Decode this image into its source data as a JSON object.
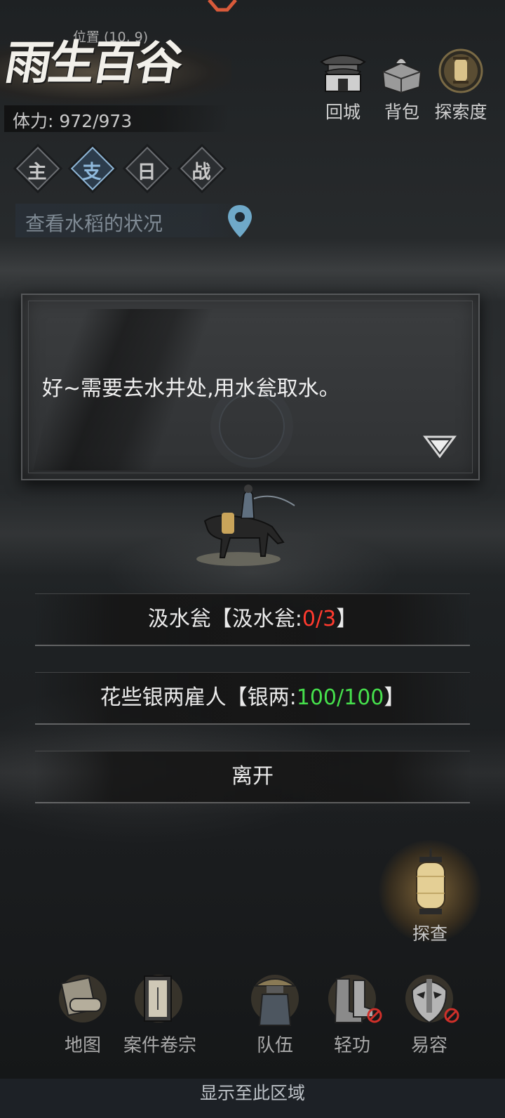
{
  "header": {
    "location_label": "位置",
    "location_coords": "(10, 9)",
    "place_name": "雨生百谷",
    "stamina_label": "体力:",
    "stamina_value": "972/973"
  },
  "top_buttons": [
    {
      "label": "回城",
      "icon": "town-gate-icon"
    },
    {
      "label": "背包",
      "icon": "bag-icon"
    },
    {
      "label": "探索度",
      "icon": "lantern-icon"
    }
  ],
  "tabs": [
    {
      "label": "主",
      "active": false
    },
    {
      "label": "支",
      "active": true
    },
    {
      "label": "日",
      "active": false
    },
    {
      "label": "战",
      "active": false
    }
  ],
  "quest": {
    "text": "查看水稻的状况",
    "icon": "map-pin-icon"
  },
  "dialog": {
    "text": "好~需要去水井处,用水瓮取水。"
  },
  "choices": [
    {
      "label": "汲水瓮【汲水瓮:",
      "count": "0/3",
      "count_color": "red",
      "suffix": "】"
    },
    {
      "label": "花些银两雇人【银两:",
      "count": "100/100",
      "count_color": "green",
      "suffix": "】"
    },
    {
      "label": "离开"
    }
  ],
  "explore_button": {
    "label": "探查",
    "icon": "lantern-icon"
  },
  "bottom_nav": [
    {
      "label": "地图",
      "icon": "scroll-map-icon",
      "disabled": false
    },
    {
      "label": "案件卷宗",
      "icon": "case-file-icon",
      "disabled": false
    },
    {
      "label": "队伍",
      "icon": "straw-hat-figure-icon",
      "disabled": false
    },
    {
      "label": "轻功",
      "icon": "boots-icon",
      "disabled": true
    },
    {
      "label": "易容",
      "icon": "mask-icon",
      "disabled": true
    }
  ],
  "footer": {
    "text": "显示至此区域"
  },
  "colors": {
    "count_red": "#ff3a2e",
    "count_green": "#46e04c",
    "tab_active": "#8fb9dc",
    "pin": "#6fa9c9"
  }
}
